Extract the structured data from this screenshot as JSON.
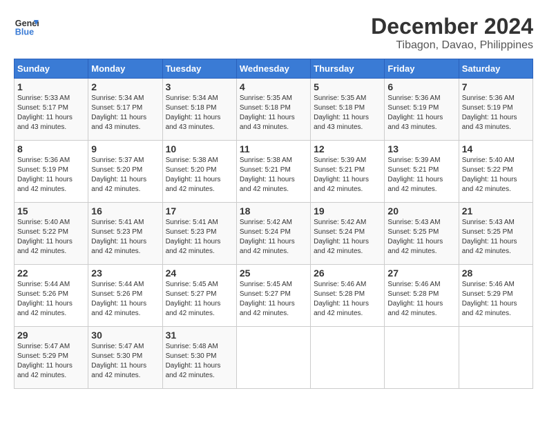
{
  "logo": {
    "line1": "General",
    "line2": "Blue"
  },
  "title": "December 2024",
  "location": "Tibagon, Davao, Philippines",
  "weekdays": [
    "Sunday",
    "Monday",
    "Tuesday",
    "Wednesday",
    "Thursday",
    "Friday",
    "Saturday"
  ],
  "weeks": [
    [
      {
        "day": "1",
        "sunrise": "5:33 AM",
        "sunset": "5:17 PM",
        "daylight": "11 hours and 43 minutes."
      },
      {
        "day": "2",
        "sunrise": "5:34 AM",
        "sunset": "5:17 PM",
        "daylight": "11 hours and 43 minutes."
      },
      {
        "day": "3",
        "sunrise": "5:34 AM",
        "sunset": "5:18 PM",
        "daylight": "11 hours and 43 minutes."
      },
      {
        "day": "4",
        "sunrise": "5:35 AM",
        "sunset": "5:18 PM",
        "daylight": "11 hours and 43 minutes."
      },
      {
        "day": "5",
        "sunrise": "5:35 AM",
        "sunset": "5:18 PM",
        "daylight": "11 hours and 43 minutes."
      },
      {
        "day": "6",
        "sunrise": "5:36 AM",
        "sunset": "5:19 PM",
        "daylight": "11 hours and 43 minutes."
      },
      {
        "day": "7",
        "sunrise": "5:36 AM",
        "sunset": "5:19 PM",
        "daylight": "11 hours and 43 minutes."
      }
    ],
    [
      {
        "day": "8",
        "sunrise": "5:36 AM",
        "sunset": "5:19 PM",
        "daylight": "11 hours and 42 minutes."
      },
      {
        "day": "9",
        "sunrise": "5:37 AM",
        "sunset": "5:20 PM",
        "daylight": "11 hours and 42 minutes."
      },
      {
        "day": "10",
        "sunrise": "5:38 AM",
        "sunset": "5:20 PM",
        "daylight": "11 hours and 42 minutes."
      },
      {
        "day": "11",
        "sunrise": "5:38 AM",
        "sunset": "5:21 PM",
        "daylight": "11 hours and 42 minutes."
      },
      {
        "day": "12",
        "sunrise": "5:39 AM",
        "sunset": "5:21 PM",
        "daylight": "11 hours and 42 minutes."
      },
      {
        "day": "13",
        "sunrise": "5:39 AM",
        "sunset": "5:21 PM",
        "daylight": "11 hours and 42 minutes."
      },
      {
        "day": "14",
        "sunrise": "5:40 AM",
        "sunset": "5:22 PM",
        "daylight": "11 hours and 42 minutes."
      }
    ],
    [
      {
        "day": "15",
        "sunrise": "5:40 AM",
        "sunset": "5:22 PM",
        "daylight": "11 hours and 42 minutes."
      },
      {
        "day": "16",
        "sunrise": "5:41 AM",
        "sunset": "5:23 PM",
        "daylight": "11 hours and 42 minutes."
      },
      {
        "day": "17",
        "sunrise": "5:41 AM",
        "sunset": "5:23 PM",
        "daylight": "11 hours and 42 minutes."
      },
      {
        "day": "18",
        "sunrise": "5:42 AM",
        "sunset": "5:24 PM",
        "daylight": "11 hours and 42 minutes."
      },
      {
        "day": "19",
        "sunrise": "5:42 AM",
        "sunset": "5:24 PM",
        "daylight": "11 hours and 42 minutes."
      },
      {
        "day": "20",
        "sunrise": "5:43 AM",
        "sunset": "5:25 PM",
        "daylight": "11 hours and 42 minutes."
      },
      {
        "day": "21",
        "sunrise": "5:43 AM",
        "sunset": "5:25 PM",
        "daylight": "11 hours and 42 minutes."
      }
    ],
    [
      {
        "day": "22",
        "sunrise": "5:44 AM",
        "sunset": "5:26 PM",
        "daylight": "11 hours and 42 minutes."
      },
      {
        "day": "23",
        "sunrise": "5:44 AM",
        "sunset": "5:26 PM",
        "daylight": "11 hours and 42 minutes."
      },
      {
        "day": "24",
        "sunrise": "5:45 AM",
        "sunset": "5:27 PM",
        "daylight": "11 hours and 42 minutes."
      },
      {
        "day": "25",
        "sunrise": "5:45 AM",
        "sunset": "5:27 PM",
        "daylight": "11 hours and 42 minutes."
      },
      {
        "day": "26",
        "sunrise": "5:46 AM",
        "sunset": "5:28 PM",
        "daylight": "11 hours and 42 minutes."
      },
      {
        "day": "27",
        "sunrise": "5:46 AM",
        "sunset": "5:28 PM",
        "daylight": "11 hours and 42 minutes."
      },
      {
        "day": "28",
        "sunrise": "5:46 AM",
        "sunset": "5:29 PM",
        "daylight": "11 hours and 42 minutes."
      }
    ],
    [
      {
        "day": "29",
        "sunrise": "5:47 AM",
        "sunset": "5:29 PM",
        "daylight": "11 hours and 42 minutes."
      },
      {
        "day": "30",
        "sunrise": "5:47 AM",
        "sunset": "5:30 PM",
        "daylight": "11 hours and 42 minutes."
      },
      {
        "day": "31",
        "sunrise": "5:48 AM",
        "sunset": "5:30 PM",
        "daylight": "11 hours and 42 minutes."
      },
      null,
      null,
      null,
      null
    ]
  ],
  "labels": {
    "sunrise_prefix": "Sunrise: ",
    "sunset_prefix": "Sunset: ",
    "daylight_prefix": "Daylight: "
  }
}
